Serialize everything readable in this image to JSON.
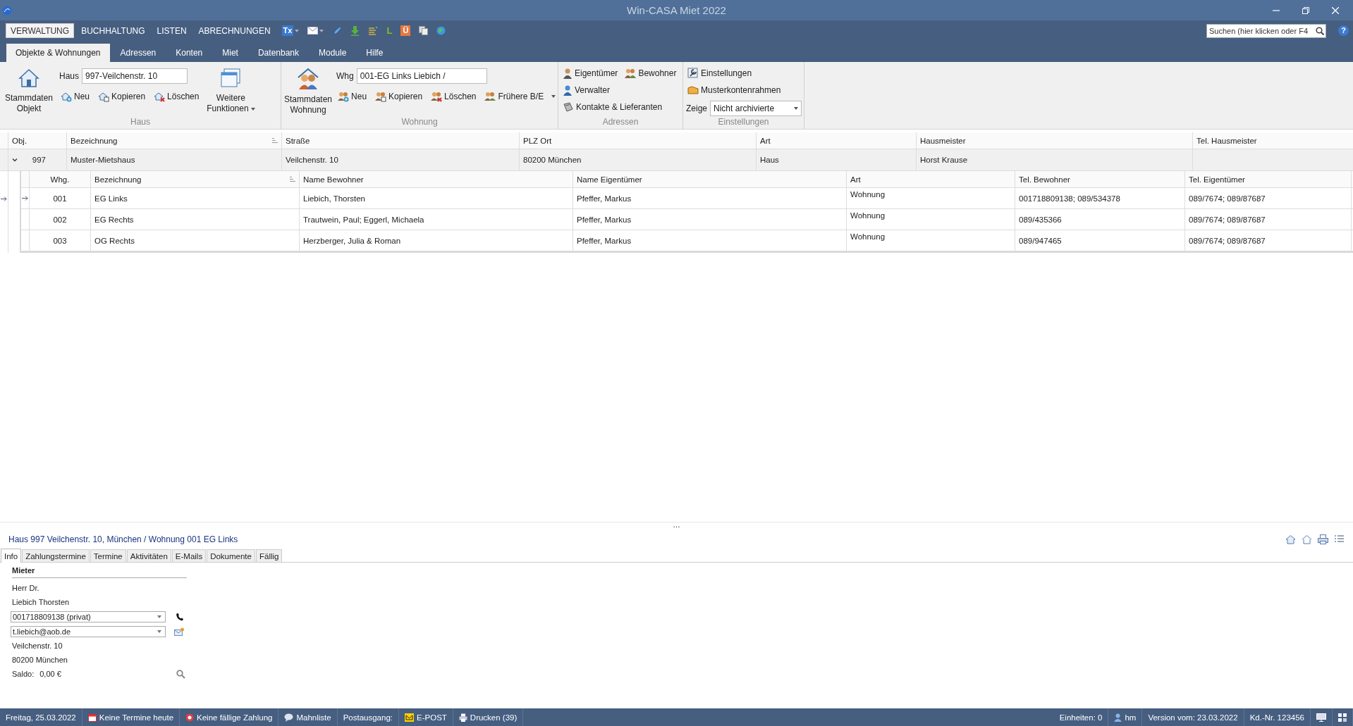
{
  "window": {
    "title": "Win-CASA Miet 2022"
  },
  "menu": [
    {
      "label": "VERWALTUNG",
      "selected": true
    },
    {
      "label": "BUCHHALTUNG",
      "selected": false
    },
    {
      "label": "LISTEN",
      "selected": false
    },
    {
      "label": "ABRECHNUNGEN",
      "selected": false
    }
  ],
  "quick_tools": [
    {
      "kind": "tx",
      "label": "Tx",
      "dropdown": true
    },
    {
      "kind": "mail",
      "dropdown": true
    },
    {
      "kind": "pen",
      "dropdown": false
    },
    {
      "kind": "download",
      "dropdown": false
    },
    {
      "kind": "list",
      "dropdown": false
    },
    {
      "kind": "letter",
      "label": "L",
      "dropdown": false
    },
    {
      "kind": "badge",
      "label": "Ü",
      "dropdown": false
    },
    {
      "kind": "copy",
      "dropdown": false
    },
    {
      "kind": "globe",
      "dropdown": false
    }
  ],
  "search": {
    "placeholder": "Suchen (hier klicken oder F4"
  },
  "help": {
    "label": "?"
  },
  "ribbon_tabs": [
    {
      "label": "Objekte & Wohnungen",
      "selected": true
    },
    {
      "label": "Adressen",
      "selected": false
    },
    {
      "label": "Konten",
      "selected": false
    },
    {
      "label": "Miet",
      "selected": false
    },
    {
      "label": "Datenbank",
      "selected": false
    },
    {
      "label": "Module",
      "selected": false
    },
    {
      "label": "Hilfe",
      "selected": false
    }
  ],
  "ribbon": {
    "haus": {
      "title": "Haus",
      "main_button": "Stammdaten Objekt",
      "field_label": "Haus",
      "field_value": "997-Veilchenstr. 10",
      "buttons": [
        "Neu",
        "Kopieren",
        "Löschen"
      ],
      "more_button": "Weitere Funktionen"
    },
    "wohnung": {
      "title": "Wohnung",
      "main_button": "Stammdaten Wohnung",
      "field_label": "Whg",
      "field_value": "001-EG Links Liebich /",
      "buttons": [
        "Neu",
        "Kopieren",
        "Löschen",
        "Frühere B/E"
      ]
    },
    "adressen": {
      "title": "Adressen",
      "buttons": [
        "Eigentümer",
        "Bewohner",
        "Verwalter",
        "Kontakte & Lieferanten"
      ]
    },
    "einstellungen": {
      "title": "Einstellungen",
      "buttons": [
        "Einstellungen",
        "Musterkontenrahmen"
      ],
      "select_label": "Zeige",
      "select_value": "Nicht archivierte"
    }
  },
  "grid": {
    "columns": [
      "Obj.",
      "Bezeichnung",
      "Straße",
      "PLZ Ort",
      "Art",
      "Hausmeister",
      "Tel. Hausmeister"
    ],
    "rows": [
      {
        "expanded": true,
        "cells": [
          "997",
          "Muster-Mietshaus",
          "Veilchenstr. 10",
          "80200 München",
          "Haus",
          "Horst Krause"
        ],
        "detail": {
          "columns": [
            "Whg.",
            "Bezeichnung",
            "Name Bewohner",
            "Name Eigentümer",
            "Art",
            "Tel. Bewohner",
            "Tel. Eigentümer"
          ],
          "rows": [
            {
              "selected": true,
              "cells": [
                "001",
                "EG Links",
                "Liebich, Thorsten",
                "Pfeffer, Markus",
                "Wohnung",
                "001718809138; 089/534378",
                "089/7674; 089/87687"
              ]
            },
            {
              "selected": false,
              "cells": [
                "002",
                "EG Rechts",
                "Trautwein, Paul; Eggerl, Michaela",
                "Pfeffer, Markus",
                "Wohnung",
                "089/435366",
                "089/7674; 089/87687"
              ]
            },
            {
              "selected": false,
              "cells": [
                "003",
                "OG Rechts",
                "Herzberger, Julia & Roman",
                "Pfeffer, Markus",
                "Wohnung",
                "089/947465",
                "089/7674; 089/87687"
              ]
            }
          ]
        }
      }
    ]
  },
  "splitter": {
    "label": "..."
  },
  "details": {
    "breadcrumb": "Haus 997 Veilchenstr. 10, München / Wohnung 001 EG Links",
    "tabs": [
      {
        "label": "Info",
        "selected": true
      },
      {
        "label": "Zahlungstermine",
        "selected": false
      },
      {
        "label": "Termine",
        "selected": false
      },
      {
        "label": "Aktivitäten",
        "selected": false
      },
      {
        "label": "E-Mails",
        "selected": false
      },
      {
        "label": "Dokumente",
        "selected": false
      },
      {
        "label": "Fällig",
        "selected": false
      }
    ],
    "info": {
      "section": "Mieter",
      "salutation": "Herr Dr.",
      "name": "Liebich Thorsten",
      "phone": "001718809138 (privat)",
      "email": "t.liebich@aob.de",
      "street": "Veilchenstr. 10",
      "city": "80200 München",
      "saldo_label": "Saldo:",
      "saldo_value": "0,00 €"
    }
  },
  "status_bar": {
    "left": [
      {
        "kind": "text",
        "text": "Freitag, 25.03.2022"
      },
      {
        "kind": "calendar",
        "text": "Keine Termine heute"
      },
      {
        "kind": "alert",
        "text": "Keine fällige Zahlung"
      },
      {
        "kind": "bubble",
        "text": "Mahnliste"
      },
      {
        "kind": "text",
        "text": "Postausgang:"
      },
      {
        "kind": "epost",
        "text": "E-POST"
      },
      {
        "kind": "printer",
        "text": "Drucken (39)"
      }
    ],
    "right": [
      {
        "kind": "text",
        "text": "Einheiten: 0"
      },
      {
        "kind": "user",
        "text": "hm"
      },
      {
        "kind": "text",
        "text": "Version vom: 23.03.2022"
      },
      {
        "kind": "text",
        "text": "Kd.-Nr. 123456"
      },
      {
        "kind": "monitor"
      },
      {
        "kind": "grid"
      }
    ]
  }
}
